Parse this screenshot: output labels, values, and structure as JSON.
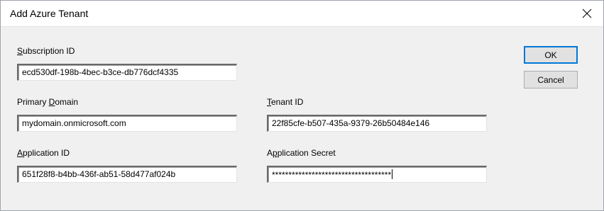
{
  "window": {
    "title": "Add Azure Tenant",
    "close_icon": "close-icon"
  },
  "fields": {
    "subscription_id": {
      "label_prefix": "",
      "label_accel": "S",
      "label_rest": "ubscription ID",
      "value": "ecd530df-198b-4bec-b3ce-db776dcf4335"
    },
    "primary_domain": {
      "label_prefix": "Primary ",
      "label_accel": "D",
      "label_rest": "omain",
      "value": "mydomain.onmicrosoft.com"
    },
    "tenant_id": {
      "label_prefix": "",
      "label_accel": "T",
      "label_rest": "enant ID",
      "value": "22f85cfe-b507-435a-9379-26b50484e146"
    },
    "application_id": {
      "label_prefix": "",
      "label_accel": "A",
      "label_rest": "pplication ID",
      "value": "651f28f8-b4bb-436f-ab51-58d477af024b"
    },
    "application_secret": {
      "label_prefix": "A",
      "label_accel": "p",
      "label_rest": "plication Secret",
      "value": "************************************"
    }
  },
  "buttons": {
    "ok": "OK",
    "cancel": "Cancel"
  }
}
